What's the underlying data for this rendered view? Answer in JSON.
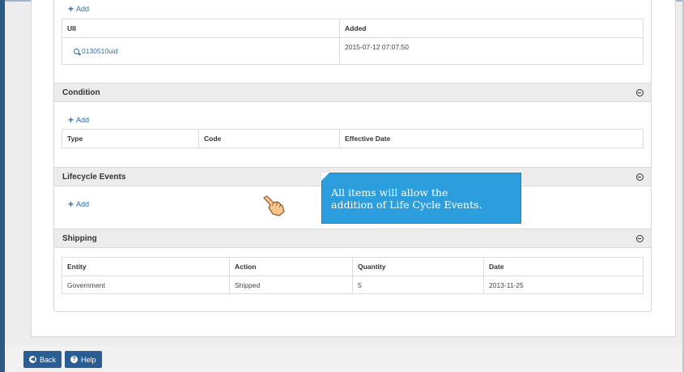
{
  "uii_section": {
    "add_label": "Add",
    "columns": [
      "UII",
      "Added"
    ],
    "rows": [
      {
        "uii": "0130510uid",
        "added": "2015-07-12 07:07:50"
      }
    ]
  },
  "condition": {
    "title": "Condition",
    "add_label": "Add",
    "columns": [
      "Type",
      "Code",
      "Effective Date"
    ]
  },
  "lifecycle": {
    "title": "Lifecycle Events",
    "add_label": "Add"
  },
  "shipping": {
    "title": "Shipping",
    "columns": [
      "Entity",
      "Action",
      "Quantity",
      "Date"
    ],
    "rows": [
      {
        "entity": "Government",
        "action": "Shipped",
        "quantity": "5",
        "date": "2013-11-25"
      }
    ]
  },
  "callout": {
    "line1": "All items will allow the",
    "line2": "addition of  Life Cycle Events."
  },
  "footer": {
    "back_label": "Back",
    "help_label": "Help"
  },
  "colors": {
    "accent_blue": "#2a6fb2",
    "button_blue": "#2a5d94",
    "callout_blue": "#2c9ede",
    "section_header_bg": "#ececec"
  },
  "icons": [
    "plus-icon",
    "magnifier-icon",
    "collapse-icon",
    "hand-pointer-icon",
    "back-circle-icon",
    "help-circle-icon"
  ]
}
